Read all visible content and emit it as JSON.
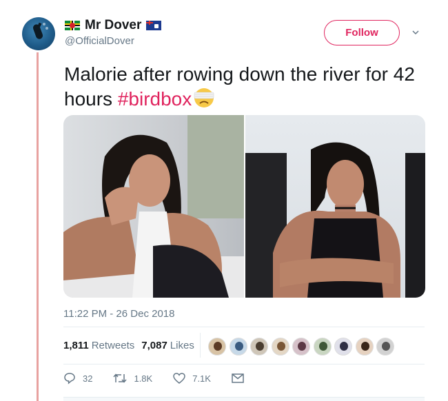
{
  "author": {
    "display_name": "Mr Dover",
    "handle": "@OfficialDover",
    "avatar_icon": "scuba-diver-avatar",
    "name_flags": [
      "dominica-flag-emoji",
      "montserrat-flag-emoji"
    ]
  },
  "follow_button": {
    "label": "Follow"
  },
  "tweet": {
    "text_before_hashtag": "Malorie after rowing down the river for 42 hours ",
    "hashtag": "#birdbox",
    "emoji": "blindfolded-face-emoji"
  },
  "media": {
    "count": 2,
    "photos": [
      "photo-woman-seated-muscular-arms",
      "photo-woman-arms-crossed-muscular"
    ]
  },
  "timestamp": "11:22 PM - 26 Dec 2018",
  "stats": {
    "retweets_count": "1,811",
    "retweets_label": "Retweets",
    "likes_count": "7,087",
    "likes_label": "Likes",
    "liker_avatar_count": 9
  },
  "actions": {
    "reply_count": "32",
    "retweet_count": "1.8K",
    "like_count": "7.1K"
  },
  "colors": {
    "accent": "#e0245e",
    "secondary_text": "#657786",
    "thread_line": "#e8a2a0",
    "divider": "#e6ecf0"
  }
}
